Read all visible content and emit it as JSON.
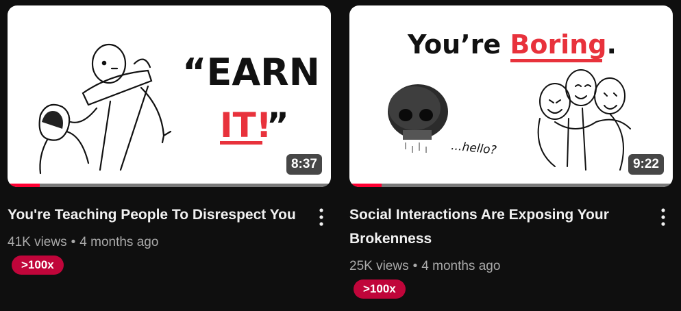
{
  "videos": [
    {
      "title": "You're Teaching People To Disrespect You",
      "duration": "8:37",
      "views": "41K views",
      "age": "4 months ago",
      "speed_badge": ">100x",
      "watched_fraction": 0.1,
      "thumbnail_text": {
        "line1": "“EARN",
        "line2": "IT!",
        "line2_suffix": "”"
      }
    },
    {
      "title": "Social Interactions Are Exposing Your Brokenness",
      "duration": "9:22",
      "views": "25K views",
      "age": "4 months ago",
      "speed_badge": ">100x",
      "watched_fraction": 0.1,
      "thumbnail_text": {
        "prefix": "You’re ",
        "highlight": "Boring",
        "suffix": ".",
        "caption": "...hello?"
      }
    }
  ],
  "colors": {
    "accent": "#ff0033",
    "highlight": "#e8323c",
    "badge": "#c0053a"
  },
  "separator": "•"
}
